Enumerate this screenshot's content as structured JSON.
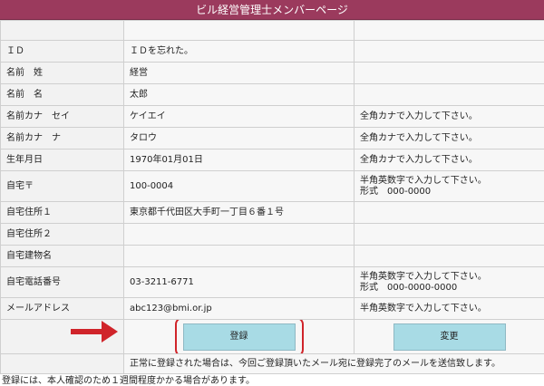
{
  "header": {
    "title": "ビル経営管理士メンバーページ"
  },
  "rows": [
    {
      "label": "",
      "value": "",
      "note": ""
    },
    {
      "label": "ＩＤ",
      "value": "ＩＤを忘れた。",
      "note": ""
    },
    {
      "label": "名前　姓",
      "value": "経営",
      "note": ""
    },
    {
      "label": "名前　名",
      "value": "太郎",
      "note": ""
    },
    {
      "label": "名前カナ　セイ",
      "value": "ケイエイ",
      "note": "全角カナで入力して下さい。"
    },
    {
      "label": "名前カナ　ナ",
      "value": "タロウ",
      "note": "全角カナで入力して下さい。"
    },
    {
      "label": "生年月日",
      "value": "1970年01月01日",
      "note": "全角カナで入力して下さい。"
    },
    {
      "label": "自宅〒",
      "value": "100-0004",
      "note": "半角英数字で入力して下さい。",
      "note2": "形式　000-0000"
    },
    {
      "label": "自宅住所１",
      "value": "東京都千代田区大手町一丁目６番１号",
      "note": ""
    },
    {
      "label": "自宅住所２",
      "value": "",
      "note": ""
    },
    {
      "label": "自宅建物名",
      "value": "",
      "note": ""
    },
    {
      "label": "自宅電話番号",
      "value": "03-3211-6771",
      "note": "半角英数字で入力して下さい。",
      "note2": "形式　000-0000-0000"
    },
    {
      "label": "メールアドレス",
      "value": "abc123@bmi.or.jp",
      "note": "半角英数字で入力して下さい。"
    }
  ],
  "buttons": {
    "register": "登録",
    "change": "変更"
  },
  "notice": "正常に登録された場合は、今回ご登録頂いたメール宛に登録完了のメールを送信致します。",
  "footer_note": "登録には、本人確認のため１週間程度かかる場合があります。",
  "colors": {
    "header_bg": "#9b3a5d",
    "button_bg": "#a8dbe5",
    "highlight": "#d0242a",
    "arrow": "#d0242a"
  }
}
